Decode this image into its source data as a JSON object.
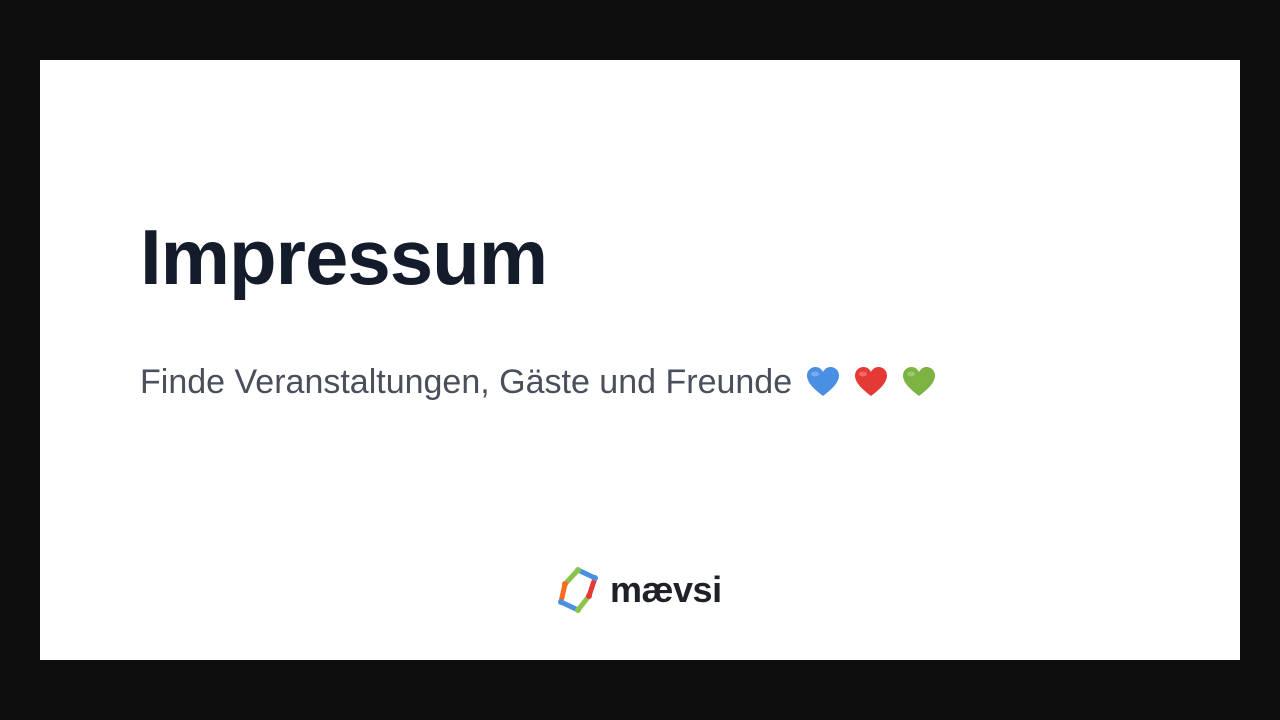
{
  "page": {
    "title": "Impressum",
    "tagline": "Finde Veranstaltungen, Gäste und Freunde",
    "hearts": [
      "blue-heart",
      "red-heart",
      "green-heart"
    ]
  },
  "brand": {
    "name": "mævsi",
    "colors": {
      "blue": "#4a90e2",
      "red": "#e53935",
      "green": "#8bc34a",
      "orange": "#ff6b1a"
    }
  },
  "colors": {
    "background": "#0e0e0e",
    "card": "#ffffff",
    "title": "#141c2c",
    "subtitle": "#4a4f5c"
  }
}
